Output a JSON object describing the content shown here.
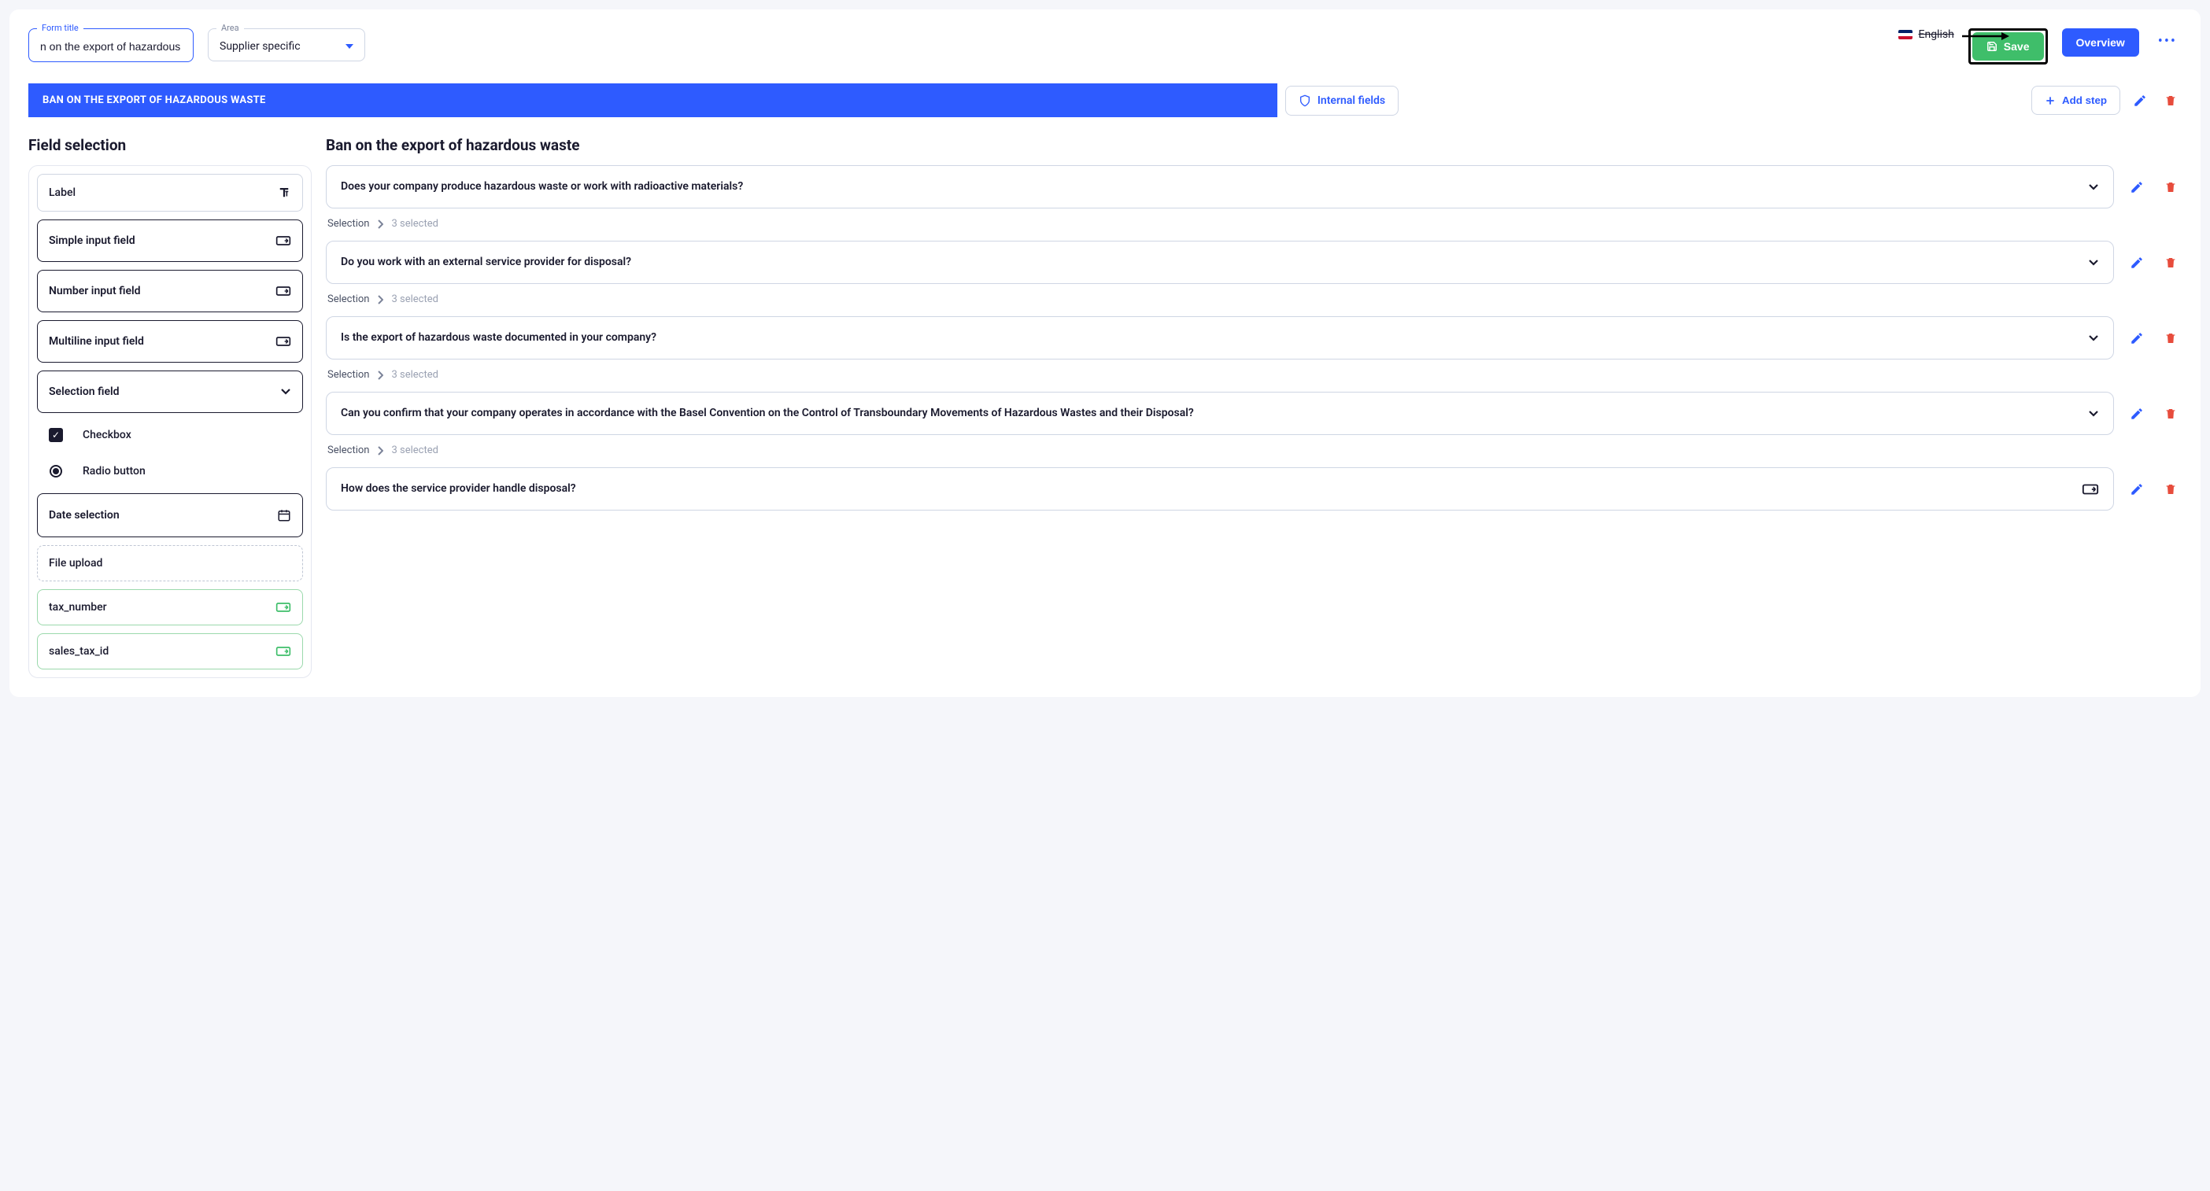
{
  "header": {
    "form_title_label": "Form title",
    "form_title_value": "n on the export of hazardous waste",
    "area_label": "Area",
    "area_value": "Supplier specific",
    "language": "English",
    "save_label": "Save",
    "overview_label": "Overview"
  },
  "tabs": {
    "main_tab": "BAN ON THE EXPORT OF HAZARDOUS WASTE",
    "internal_fields": "Internal fields",
    "add_step": "Add step"
  },
  "field_selection": {
    "title": "Field selection",
    "items": [
      {
        "label": "Label"
      },
      {
        "label": "Simple input field"
      },
      {
        "label": "Number input field"
      },
      {
        "label": "Multiline input field"
      },
      {
        "label": "Selection field"
      },
      {
        "label": "Checkbox"
      },
      {
        "label": "Radio button"
      },
      {
        "label": "Date selection"
      },
      {
        "label": "File upload"
      },
      {
        "label": "tax_number"
      },
      {
        "label": "sales_tax_id"
      }
    ]
  },
  "form": {
    "title": "Ban on the export of hazardous waste",
    "selection_word": "Selection",
    "selected_suffix": "selected",
    "questions": [
      {
        "text": "Does your company produce hazardous waste or work with radioactive materials?",
        "type": "selection",
        "selected": 3
      },
      {
        "text": "Do you work with an external service provider for disposal?",
        "type": "selection",
        "selected": 3
      },
      {
        "text": "Is the export of hazardous waste documented in your company?",
        "type": "selection",
        "selected": 3
      },
      {
        "text": "Can you confirm that your company operates in accordance with the Basel Convention on the Control of Transboundary Movements of Hazardous Wastes and their Disposal?",
        "type": "selection",
        "selected": 3
      },
      {
        "text": "How does the service provider handle disposal?",
        "type": "input"
      }
    ]
  }
}
